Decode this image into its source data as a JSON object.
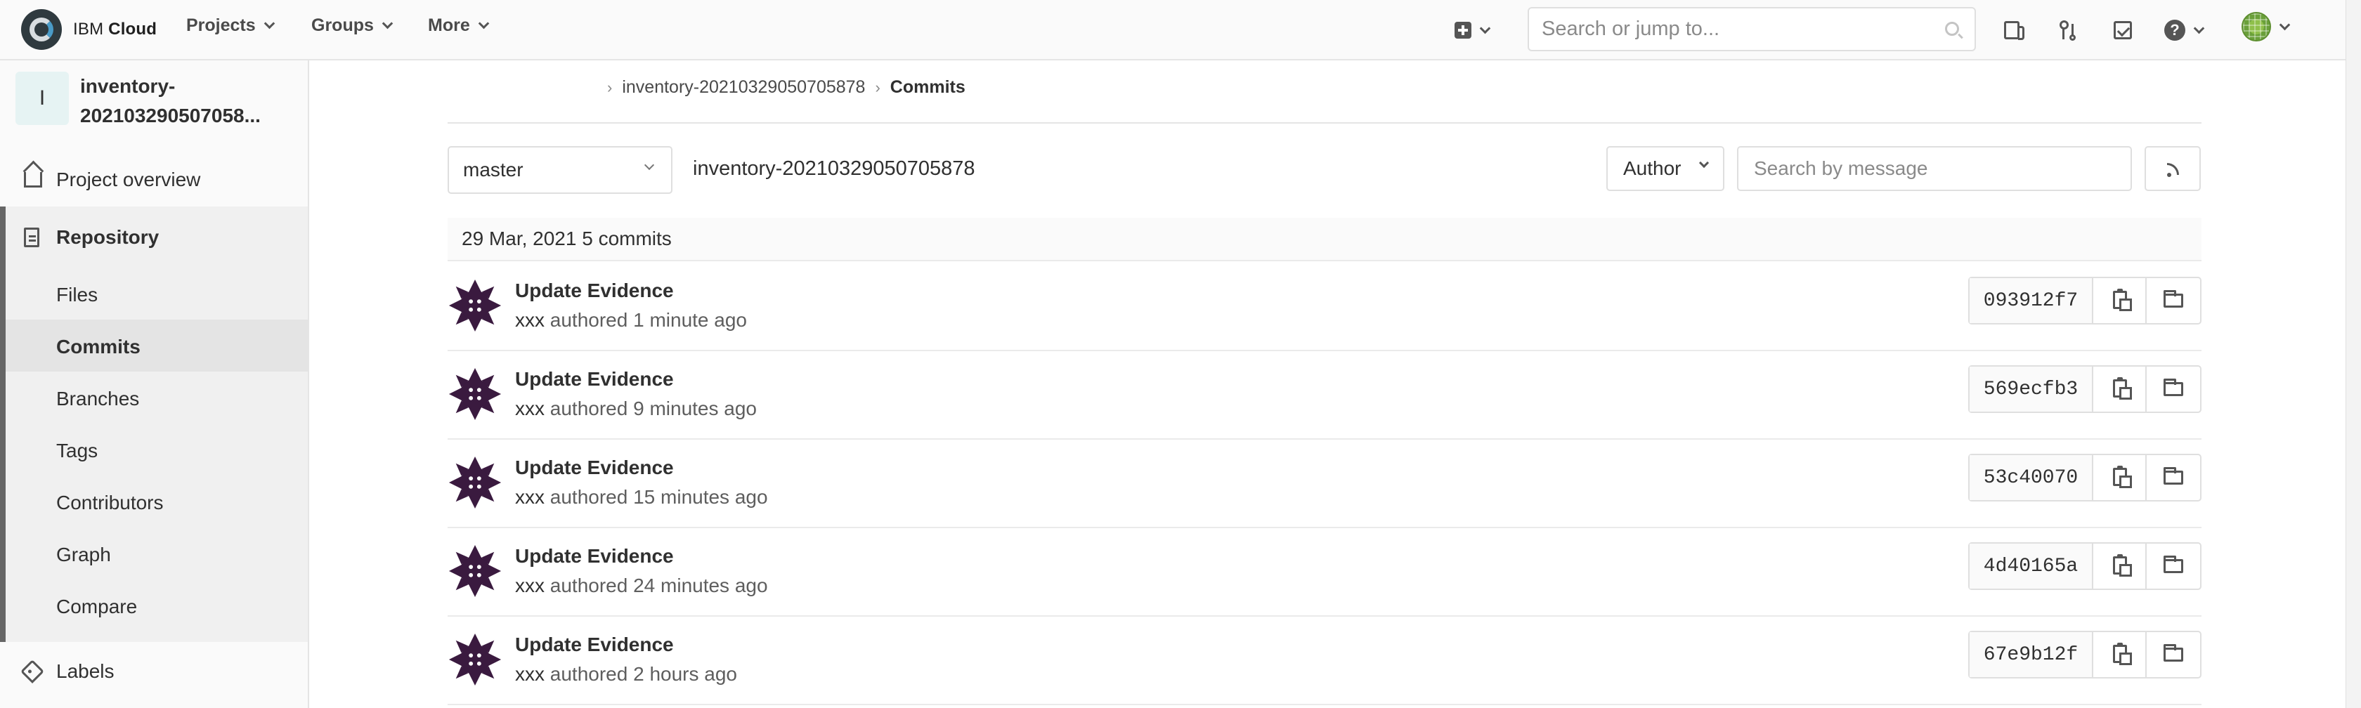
{
  "topbar": {
    "logo": {
      "brand": "IBM",
      "product": "Cloud"
    },
    "nav": [
      {
        "label": "Projects"
      },
      {
        "label": "Groups"
      },
      {
        "label": "More"
      }
    ],
    "search": {
      "placeholder": "Search or jump to..."
    },
    "icons": [
      "plus-square-icon",
      "issues-icon",
      "merge-request-icon",
      "todo-icon",
      "help-icon",
      "user-avatar"
    ]
  },
  "sidebar": {
    "project": {
      "initial": "I",
      "name_line1": "inventory-",
      "name_line2": "202103290507058..."
    },
    "overview": "Project overview",
    "repository": "Repository",
    "items": [
      {
        "label": "Files"
      },
      {
        "label": "Commits"
      },
      {
        "label": "Branches"
      },
      {
        "label": "Tags"
      },
      {
        "label": "Contributors"
      },
      {
        "label": "Graph"
      },
      {
        "label": "Compare"
      }
    ],
    "labels": "Labels"
  },
  "main": {
    "breadcrumb": {
      "project": "inventory-20210329050705878",
      "current": "Commits"
    },
    "branch": "master",
    "repo_path": "inventory-20210329050705878",
    "author_label": "Author",
    "search_placeholder": "Search by message",
    "day_header": "29 Mar, 2021 5 commits",
    "commits": [
      {
        "title": "Update Evidence",
        "author": "xxx",
        "meta": " authored 1 minute ago",
        "sha": "093912f7"
      },
      {
        "title": "Update Evidence",
        "author": "xxx",
        "meta": " authored 9 minutes ago",
        "sha": "569ecfb3"
      },
      {
        "title": "Update Evidence",
        "author": "xxx",
        "meta": " authored 15 minutes ago",
        "sha": "53c40070"
      },
      {
        "title": "Update Evidence",
        "author": "xxx",
        "meta": " authored 24 minutes ago",
        "sha": "4d40165a"
      },
      {
        "title": "Update Evidence",
        "author": "xxx",
        "meta": " authored 2 hours ago",
        "sha": "67e9b12f"
      }
    ]
  }
}
